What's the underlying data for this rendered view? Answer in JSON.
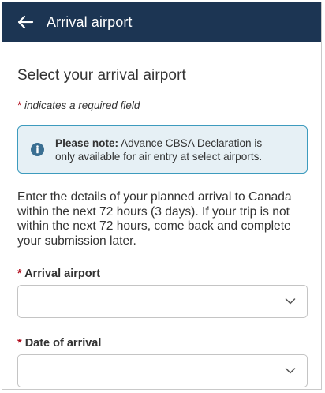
{
  "header": {
    "title": "Arrival airport",
    "background": "#1c3553"
  },
  "main": {
    "title": "Select your arrival airport",
    "required_note": {
      "star": "*",
      "text": " indicates a required field"
    },
    "notice": {
      "label": "Please note:",
      "line1_rest": " Advance CBSA Declaration is",
      "line2": "only available for air entry at select airports."
    },
    "instructions_lines": [
      "Enter the details of your planned arrival to Canada",
      "within the next 72 hours (3 days). If your trip is not",
      "within the next 72 hours, come back and complete",
      "your submission later."
    ],
    "fields": {
      "arrival_airport": {
        "star": "*",
        "label": "Arrival airport",
        "value": ""
      },
      "date_of_arrival": {
        "star": "*",
        "label": "Date of arrival",
        "value": ""
      }
    }
  },
  "colors": {
    "required_star": "#b10e1e",
    "notice_background": "#e6f0f5",
    "notice_border": "#3d9bbe",
    "info_icon": "#3a6f92"
  }
}
